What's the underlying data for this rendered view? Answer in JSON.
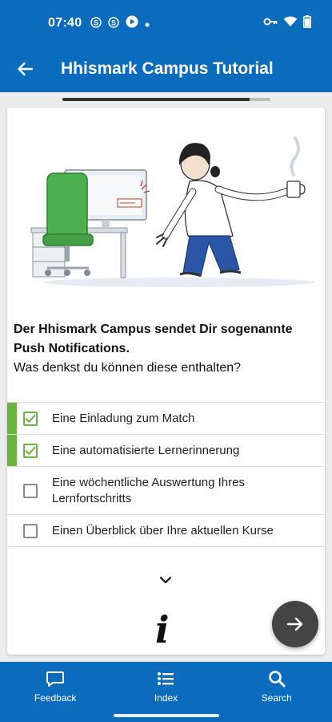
{
  "status_bar": {
    "time": "07:40",
    "left_icons": [
      "s-icon",
      "s-icon",
      "play-icon",
      "dot-icon"
    ],
    "right_icons": [
      "key-icon",
      "wifi-icon",
      "battery-icon"
    ]
  },
  "app_bar": {
    "title": "Hhismark Campus Tutorial"
  },
  "progress": {
    "value": 0.9
  },
  "question": {
    "bold_text": "Der Hhismark Campus sendet Dir sogenannte Push Notifications.",
    "normal_text": "Was denkst du können diese enthalten?"
  },
  "answers": [
    {
      "label": "Eine Einladung zum Match",
      "checked": true
    },
    {
      "label": "Eine automatisierte Lernerinnerung",
      "checked": true
    },
    {
      "label": "Eine wöchentliche Auswertung Ihres Lernfortschritts",
      "checked": false
    },
    {
      "label": "Einen Überblick über Ihre aktuellen Kurse",
      "checked": false
    }
  ],
  "info_glyph": "i",
  "bottom_nav": {
    "feedback": "Feedback",
    "index": "Index",
    "search": "Search"
  },
  "colors": {
    "primary": "#0b6bbd",
    "accent_green": "#6bb33f",
    "fab": "#444444"
  }
}
